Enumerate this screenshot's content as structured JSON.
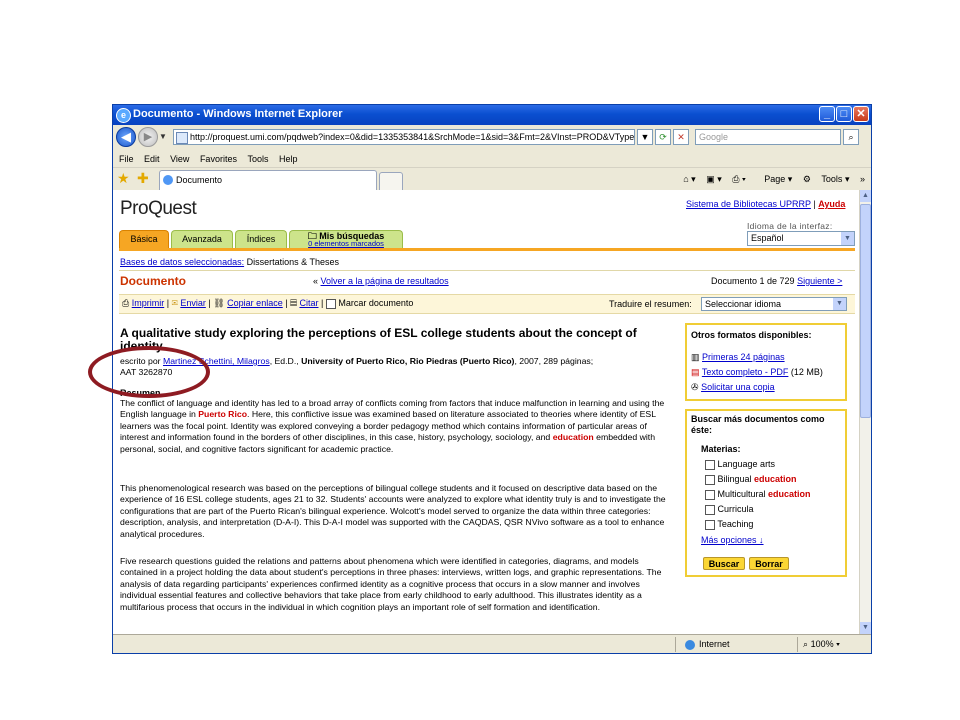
{
  "browser": {
    "title": "Documento - Windows Internet Explorer",
    "address": "http://proquest.umi.com/pqdweb?index=0&did=1335353841&SrchMode=1&sid=3&Fmt=2&VInst=PROD&VType=PQD&RQT=",
    "search_placeholder": "Google",
    "menu": [
      "File",
      "Edit",
      "View",
      "Favorites",
      "Tools",
      "Help"
    ],
    "tab_label": "Documento",
    "cmd_page": "Page",
    "cmd_tools": "Tools",
    "status_zone": "Internet",
    "zoom": "100%"
  },
  "page": {
    "logo": "ProQuest",
    "top_links": {
      "library": "Sistema de Bibliotecas UPRRP",
      "separator": "|",
      "help": "Ayuda"
    },
    "interface_language_label": "Idioma de la interfaz:",
    "interface_language_value": "Español",
    "nav_tabs": [
      "Básica",
      "Avanzada",
      "Índices"
    ],
    "my_searches": {
      "label": "Mis búsquedas",
      "sub": "0 elementos marcados"
    },
    "db_label": "Bases de datos seleccionadas:",
    "db_value": "Dissertations & Theses",
    "section_title": "Documento",
    "back_arrow": "«",
    "back_link": "Volver a la página de resultados",
    "doc_counter": "Documento 1 de 729",
    "next_link": "Siguiente >",
    "tools": {
      "print": "Imprimir",
      "send": "Enviar",
      "copy_link": "Copiar enlace",
      "cite": "Citar",
      "mark": "Marcar documento",
      "sep": "|"
    },
    "translate_label": "Traduire el resumen:",
    "translate_value": "Seleccionar idioma",
    "article": {
      "title": "A qualitative study exploring the perceptions of ESL college students about the concept of identity",
      "byline_prefix": "escrito por",
      "author": "Martinez Schettini, Milagros",
      "byline_rest": ", Ed.D., ",
      "institution": "University of Puerto Rico, Rio Piedras (Puerto Rico)",
      "byline_tail": ", 2007, 289 páginas;",
      "aat": "AAT 3262870",
      "abstract_heading": "Resumen",
      "p1": [
        {
          "t": "The conflict of language and identity has led to a broad array of conflicts coming from factors that induce malfunction in learning and using the English language in ",
          "h": false
        },
        {
          "t": "Puerto Rico",
          "h": true
        },
        {
          "t": ". Here, this conflictive issue was examined based on literature associated to theories where identity of ESL learners was the focal point. Identity was explored conveying a border pedagogy method which contains information of particular areas of interest and information found in the borders of other disciplines, in this case, history, psychology, sociology, and ",
          "h": false
        },
        {
          "t": "education",
          "h": true
        },
        {
          "t": " embedded with personal, social, and cognitive factors significant for academic practice.",
          "h": false
        }
      ],
      "p2": "This phenomenological research was based on the perceptions of bilingual college students and it focused on descriptive data based on the experience of 16 ESL college students, ages 21 to 32. Students' accounts were analyzed to explore what identity truly is and to investigate the configurations that are part of the Puerto Rican's bilingual experience. Wolcott's model served to organize the data within three categories: description, analysis, and interpretation (D-A-I). This D-A-I model was supported with the CAQDAS, QSR NVivo software as a tool to enhance analytical procedures.",
      "p3": "Five research questions guided the relations and patterns about phenomena which were identified in categories, diagrams, and models contained in a project holding the data about student's perceptions in three phases: interviews, written logs, and graphic representations. The analysis of data regarding participants' experiences confirmed identity as a cognitive process that occurs in a slow manner and involves individual essential features and collective behaviors that take place from early childhood to early adulthood. This illustrates identity as a multifarious process that occurs in the individual in which cognition plays an important role of self formation and identification."
    },
    "formats": {
      "heading": "Otros formatos disponibles:",
      "first_pages": "Primeras 24 páginas",
      "full_text": "Texto completo - PDF",
      "size": "(12 MB)",
      "request": "Solicitar una copia"
    },
    "more": {
      "heading": "Buscar más documentos como éste:",
      "subjects_label": "Materias:",
      "subjects": [
        {
          "pre": "Language arts",
          "hl": ""
        },
        {
          "pre": "Bilingual ",
          "hl": "education"
        },
        {
          "pre": "Multicultural ",
          "hl": "education"
        },
        {
          "pre": "Curricula",
          "hl": ""
        },
        {
          "pre": "Teaching",
          "hl": ""
        }
      ],
      "more_options": "Más opciones ↓",
      "search_btn": "Buscar",
      "clear_btn": "Borrar"
    }
  },
  "colors": {
    "accent_orange": "#f6a623",
    "tab_green": "#cde48b",
    "highlight_red": "#cc0000",
    "annotation": "#8e1b22",
    "box_border": "#f0cd35"
  }
}
